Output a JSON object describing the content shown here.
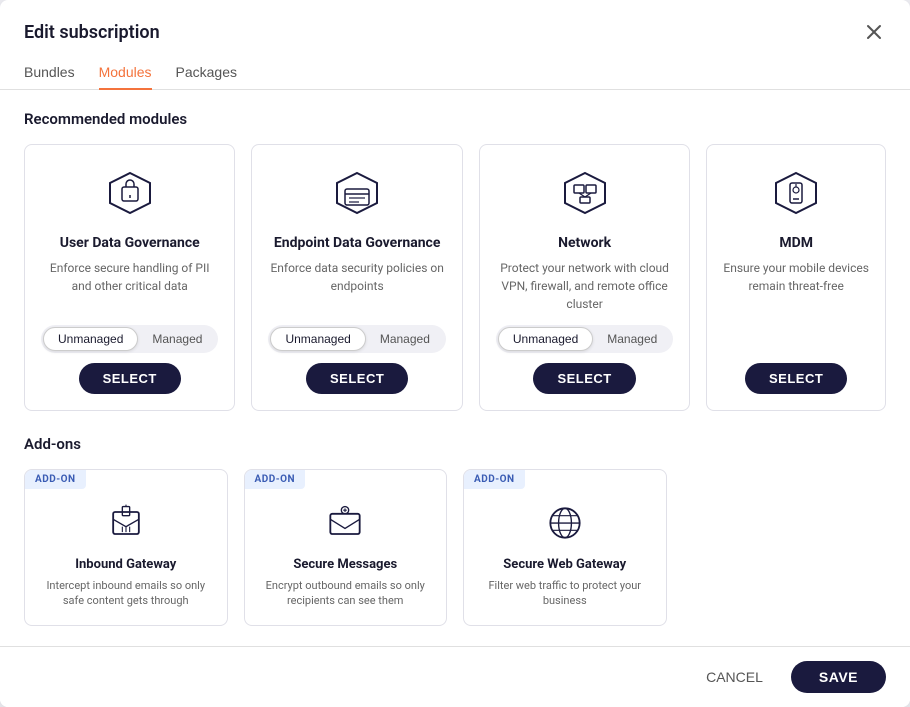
{
  "modal": {
    "title": "Edit subscription",
    "close_label": "×"
  },
  "tabs": [
    {
      "label": "Bundles",
      "active": false
    },
    {
      "label": "Modules",
      "active": true
    },
    {
      "label": "Packages",
      "active": false
    }
  ],
  "recommended_section": {
    "title": "Recommended modules"
  },
  "modules": [
    {
      "name": "User Data Governance",
      "desc": "Enforce secure handling of PII and other critical data",
      "toggle": [
        "Unmanaged",
        "Managed"
      ],
      "active_toggle": "Unmanaged",
      "select_label": "SELECT"
    },
    {
      "name": "Endpoint Data Governance",
      "desc": "Enforce data security policies on endpoints",
      "toggle": [
        "Unmanaged",
        "Managed"
      ],
      "active_toggle": "Unmanaged",
      "select_label": "SELECT"
    },
    {
      "name": "Network",
      "desc": "Protect your network with cloud VPN, firewall, and remote office cluster",
      "toggle": [
        "Unmanaged",
        "Managed"
      ],
      "active_toggle": "Unmanaged",
      "select_label": "SELECT"
    },
    {
      "name": "MDM",
      "desc": "Ensure your mobile devices remain threat-free",
      "toggle": [],
      "active_toggle": "",
      "select_label": "SELECT"
    }
  ],
  "addons_section": {
    "title": "Add-ons"
  },
  "addons": [
    {
      "badge": "ADD-ON",
      "name": "Inbound Gateway",
      "desc": "Intercept inbound emails so only safe content gets through"
    },
    {
      "badge": "ADD-ON",
      "name": "Secure Messages",
      "desc": "Encrypt outbound emails so only recipients can see them"
    },
    {
      "badge": "ADD-ON",
      "name": "Secure Web Gateway",
      "desc": "Filter web traffic to protect your business"
    }
  ],
  "footer": {
    "cancel_label": "CANCEL",
    "save_label": "SAVE"
  }
}
